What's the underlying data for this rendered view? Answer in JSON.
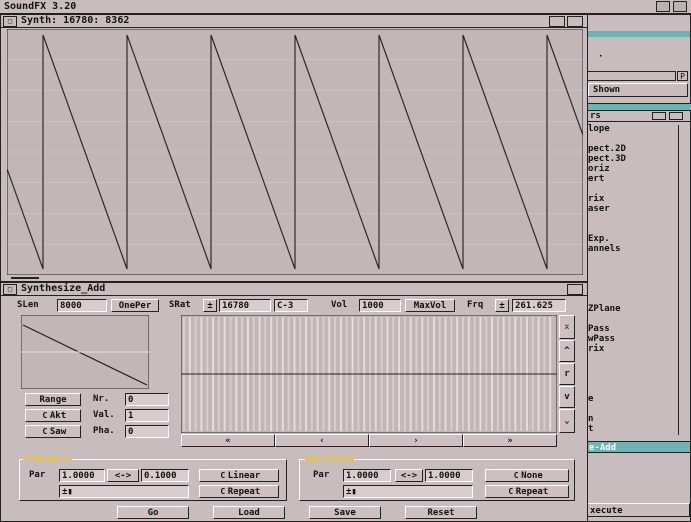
{
  "screen": {
    "title": "SoundFX 3.20"
  },
  "synth_window": {
    "title": "Synth: 16780: 8362"
  },
  "panel_window": {
    "title": "Synthesize_Add",
    "slen_label": "SLen",
    "slen_value": "8000",
    "oneper_label": "OnePer",
    "srat_label": "SRat",
    "srat_value": "16780",
    "note_value": "C-3",
    "vol_label": "Vol",
    "vol_value": "1000",
    "maxvol_label": "MaxVol",
    "frq_label": "Frq",
    "frq_value": "261.625",
    "range_label": "Range",
    "nr_label": "Nr.",
    "nr_value": "0",
    "akt_label": "Akt",
    "val_label": "Val.",
    "val_value": "1",
    "saw_label": "Saw",
    "pha_label": "Pha.",
    "pha_value": "0",
    "scroll_left2": "«",
    "scroll_left": "‹",
    "scroll_right": "›",
    "scroll_right2": "»",
    "scroll_top": "⌅",
    "scroll_up": "^",
    "scroll_mid": "r",
    "scroll_down": "v",
    "scroll_bottom": "⌄",
    "frequency": {
      "title": "Frequency",
      "par_label": "Par",
      "start_value": "1.0000",
      "swap_label": "<->",
      "end_value": "0.1000",
      "mode_label": "Linear",
      "repeat_label": "Repeat"
    },
    "amplitude": {
      "title": "Amplitude",
      "par_label": "Par",
      "start_value": "1.0000",
      "swap_label": "<->",
      "end_value": "1.0000",
      "mode_label": "None",
      "repeat_label": "Repeat"
    },
    "bottom_buttons": [
      "Go",
      "Load",
      "Save",
      "Reset"
    ]
  },
  "right_window_top": {
    "item": "Shown",
    "menu_item": "·"
  },
  "right_list": {
    "title": "rs",
    "items": [
      "lope",
      "",
      "pect.2D",
      "pect.3D",
      "oriz",
      "ert",
      "",
      "rix",
      "aser",
      "",
      "",
      "Exp.",
      "annels",
      "",
      "",
      "",
      "",
      "",
      "ZPlane",
      "",
      "Pass",
      "wPass",
      "rix",
      "",
      "",
      "",
      "",
      "e",
      "",
      "n",
      "t"
    ],
    "selected": "e-Add",
    "footer": "xecute"
  },
  "chart_data": {
    "type": "line",
    "title": "Synth: 16780: 8362",
    "series": [
      {
        "shape": "sawtooth",
        "periods_visible": 7
      }
    ],
    "colors": {
      "wave": "#2a2a2a",
      "grid": "#e8e0e2",
      "background": "#c3b6b9"
    }
  }
}
